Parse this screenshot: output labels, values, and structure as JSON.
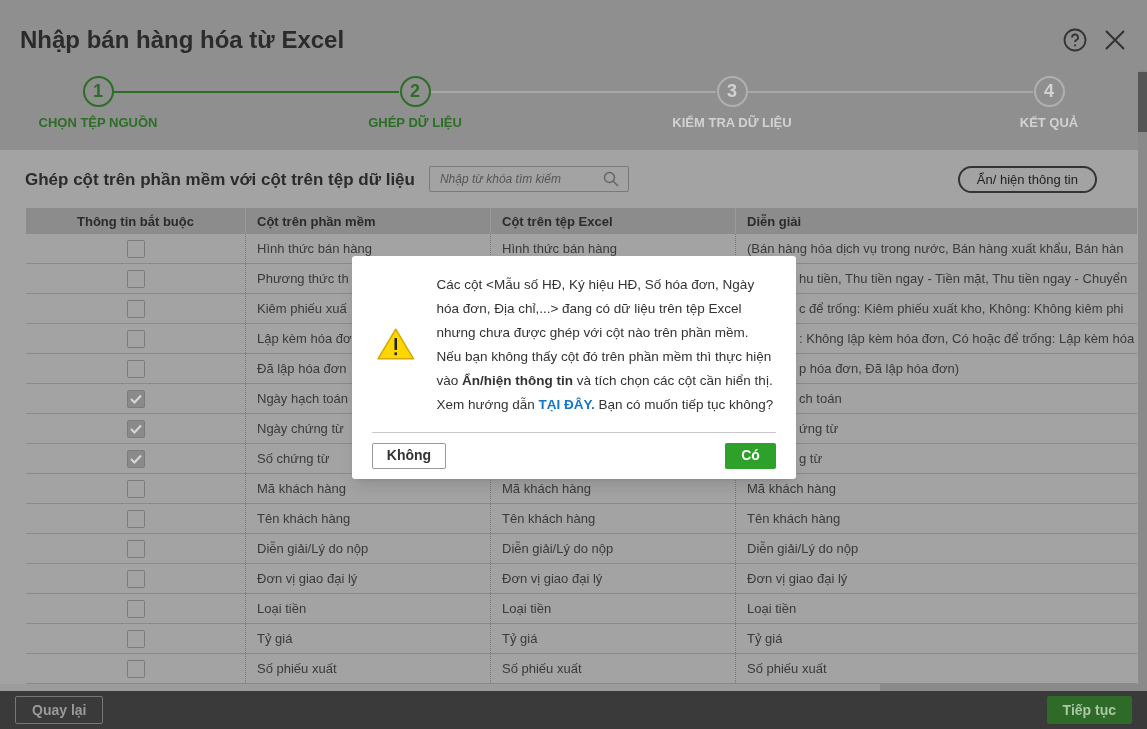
{
  "window": {
    "title": "Nhập bán hàng hóa từ Excel"
  },
  "steps": [
    {
      "number": "1",
      "label": "CHỌN TỆP NGUỒN",
      "done": true
    },
    {
      "number": "2",
      "label": "GHÉP DỮ LIỆU",
      "done": true
    },
    {
      "number": "3",
      "label": "KIỂM TRA DỮ LIỆU",
      "done": false
    },
    {
      "number": "4",
      "label": "KẾT QUẢ",
      "done": false
    }
  ],
  "section": {
    "title": "Ghép cột trên phần mềm với cột trên tệp dữ liệu",
    "search": {
      "placeholder": "Nhập từ khóa tìm kiếm"
    },
    "toggle_button": "Ẩn/ hiện thông tin"
  },
  "table": {
    "columns": [
      "Thông tin bắt buộc",
      "Cột trên phần mềm",
      "Cột trên tệp Excel",
      "Diễn giải"
    ],
    "rows": [
      {
        "checked": false,
        "covered": false,
        "software": "Hình thức bán hàng",
        "excel": "Hình thức bán hàng",
        "description": "(Bán hàng hóa dịch vụ trong nước, Bán hàng xuất khẩu, Bán hàn"
      },
      {
        "checked": false,
        "covered": true,
        "software": "Phương thức th",
        "description": "hu tiền, Thu tiền ngay - Tiền mặt, Thu tiền ngay - Chuyển"
      },
      {
        "checked": false,
        "covered": true,
        "software": "Kiêm phiếu xuấ",
        "description": "c để trống: Kiêm phiếu xuất kho, Không: Không kiêm phi"
      },
      {
        "checked": false,
        "covered": true,
        "software": "Lập kèm hóa đơ",
        "description": ": Không lập kèm hóa đơn, Có hoặc để trống: Lập kèm hóa"
      },
      {
        "checked": false,
        "covered": true,
        "software": "Đã lập hóa đơn",
        "description": "p hóa đơn, Đã lập hóa đơn)"
      },
      {
        "checked": true,
        "covered": true,
        "software": "Ngày hạch toán",
        "description": "ch toán"
      },
      {
        "checked": true,
        "covered": true,
        "software": "Ngày chứng từ",
        "description": "ứng từ"
      },
      {
        "checked": true,
        "covered": true,
        "software": "Số chứng từ",
        "description": "g từ"
      },
      {
        "checked": false,
        "covered": false,
        "software": "Mã khách hàng",
        "excel": "Mã khách hàng",
        "description": "Mã khách hàng"
      },
      {
        "checked": false,
        "covered": false,
        "software": "Tên khách hàng",
        "excel": "Tên khách hàng",
        "description": "Tên khách hàng"
      },
      {
        "checked": false,
        "covered": false,
        "software": "Diễn giải/Lý do nộp",
        "excel": "Diễn giải/Lý do nộp",
        "description": "Diễn giải/Lý do nộp"
      },
      {
        "checked": false,
        "covered": false,
        "software": "Đơn vị giao đại lý",
        "excel": "Đơn vị giao đại lý",
        "description": "Đơn vị giao đại lý"
      },
      {
        "checked": false,
        "covered": false,
        "software": "Loại tiền",
        "excel": "Loại tiền",
        "description": "Loại tiền"
      },
      {
        "checked": false,
        "covered": false,
        "software": "Tỷ giá",
        "excel": "Tỷ giá",
        "description": "Tỷ giá"
      },
      {
        "checked": false,
        "covered": false,
        "software": "Số phiếu xuất",
        "excel": "Số phiếu xuất",
        "description": "Số phiếu xuất"
      }
    ]
  },
  "dialog": {
    "message_before": "Các cột <Mẫu số HĐ, Ký hiệu HĐ, Số hóa đơn, Ngày hóa đơn, Địa chỉ,...> đang có dữ liệu trên tệp Excel nhưng chưa được ghép với cột nào trên phần mềm. Nếu bạn không thấy cột đó trên phần mềm thì thực hiện vào **Ẩn/hiện thông tin** và tích chọn các cột cần hiển thị. Xem hướng dẫn",
    "link": "TẠI ĐÂY.",
    "message_after": "Bạn có muốn tiếp tục không?",
    "buttons": [
      "Không",
      "Có"
    ]
  },
  "footer": {
    "back": "Quay lại",
    "next": "Tiếp tục"
  }
}
